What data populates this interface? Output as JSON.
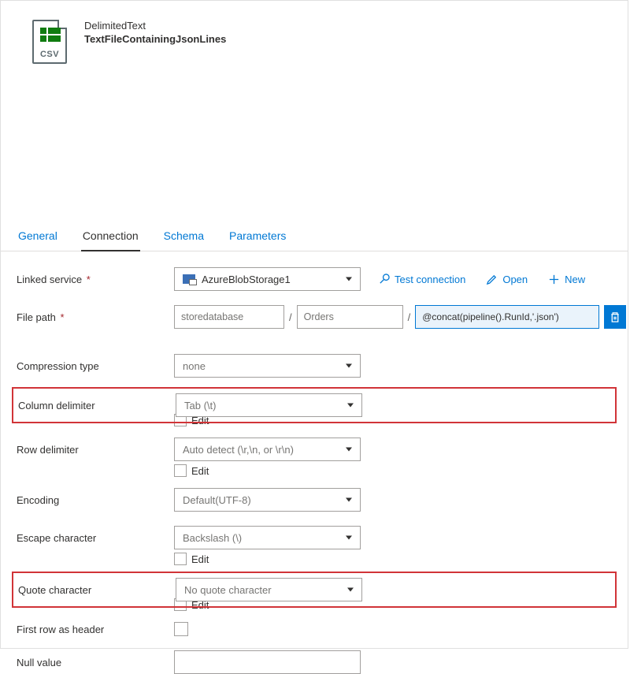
{
  "header": {
    "type_label": "DelimitedText",
    "name": "TextFileContainingJsonLines",
    "csv_label": "CSV"
  },
  "tabs": {
    "general": "General",
    "connection": "Connection",
    "schema": "Schema",
    "parameters": "Parameters"
  },
  "labels": {
    "linked_service": "Linked service",
    "file_path": "File path",
    "compression_type": "Compression type",
    "column_delimiter": "Column delimiter",
    "row_delimiter": "Row delimiter",
    "encoding": "Encoding",
    "escape_character": "Escape character",
    "quote_character": "Quote character",
    "first_row_as_header": "First row as header",
    "null_value": "Null value",
    "edit": "Edit"
  },
  "values": {
    "linked_service": "AzureBlobStorage1",
    "path_container": "storedatabase",
    "path_directory": "Orders",
    "path_file": "@concat(pipeline().RunId,'.json')",
    "compression_type": "none",
    "column_delimiter": "Tab (\\t)",
    "row_delimiter": "Auto detect (\\r,\\n, or \\r\\n)",
    "encoding": "Default(UTF-8)",
    "escape_character": "Backslash (\\)",
    "quote_character": "No quote character",
    "null_value": ""
  },
  "actions": {
    "test_connection": "Test connection",
    "open": "Open",
    "new": "New"
  }
}
